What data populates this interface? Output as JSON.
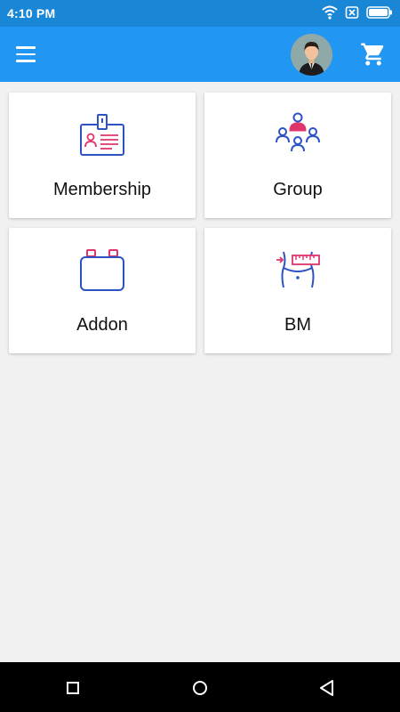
{
  "status_bar": {
    "time": "4:10 PM",
    "icons": [
      "wifi-icon",
      "sim-off-icon",
      "battery-icon"
    ]
  },
  "app_bar": {
    "menu_icon": "hamburger-menu-icon",
    "avatar_icon": "user-avatar-icon",
    "cart_icon": "shopping-cart-icon",
    "background_color": "#2196f3"
  },
  "tiles": [
    {
      "label": "Membership",
      "icon": "id-badge-icon"
    },
    {
      "label": "Group",
      "icon": "group-people-icon"
    },
    {
      "label": "Addon",
      "icon": "addon-box-icon"
    },
    {
      "label": "BM",
      "icon": "body-measurement-icon"
    }
  ],
  "nav_bar": {
    "buttons": [
      "recent-apps-icon",
      "home-icon",
      "back-icon"
    ]
  },
  "colors": {
    "icon_blue": "#2c52c4",
    "icon_pink": "#e0356a"
  }
}
